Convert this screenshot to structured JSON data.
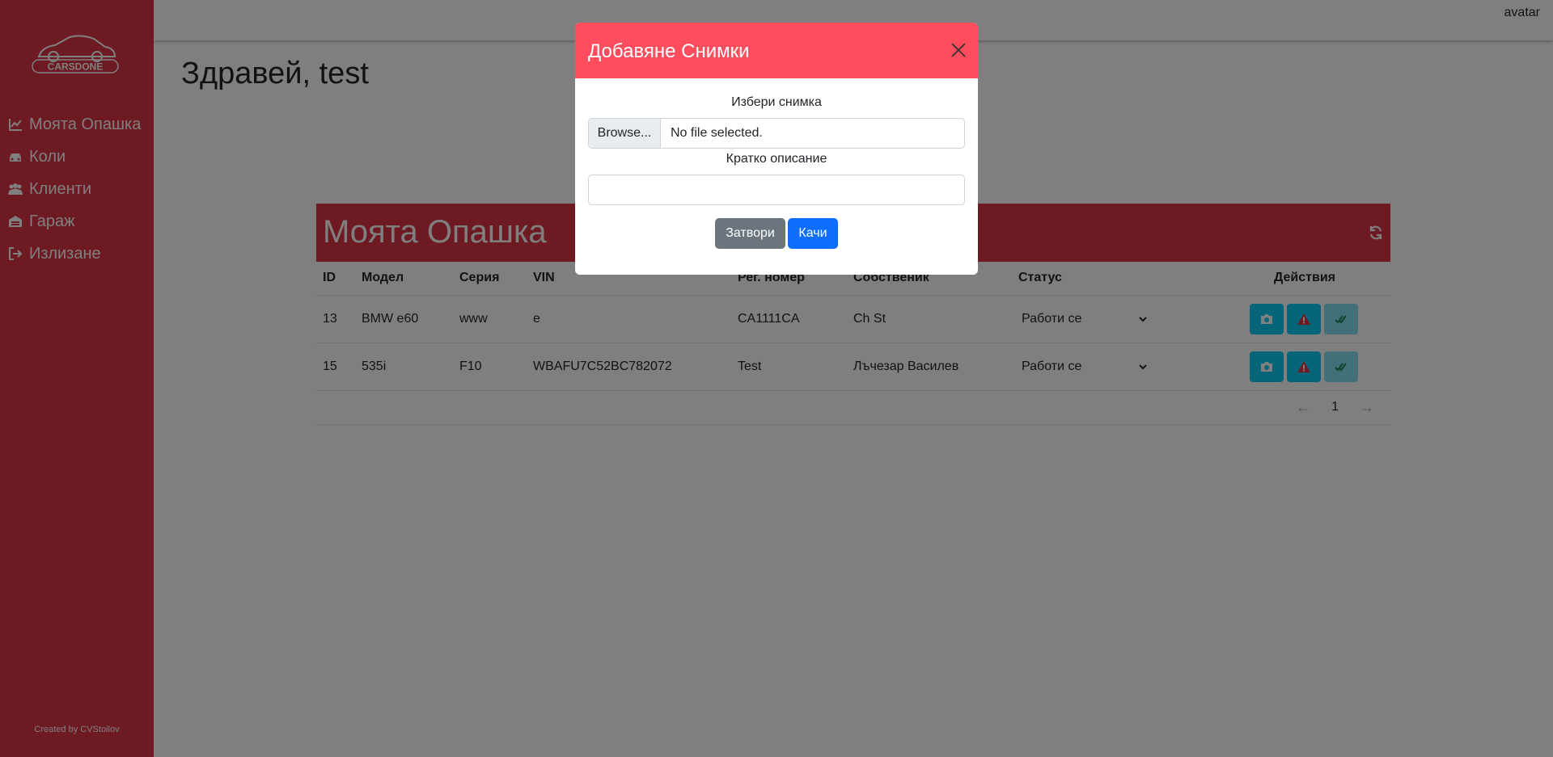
{
  "app": {
    "logo_alt": "CARSDONE",
    "user": "avatar",
    "credit": "Created by CVStoilov"
  },
  "sidebar": {
    "items": [
      {
        "label": "Моята Опашка",
        "icon": "line-chart-icon"
      },
      {
        "label": "Коли",
        "icon": "car-icon"
      },
      {
        "label": "Клиенти",
        "icon": "users-icon"
      },
      {
        "label": "Гараж",
        "icon": "warehouse-icon"
      },
      {
        "label": "Излизане",
        "icon": "sign-out-icon"
      }
    ]
  },
  "main": {
    "greeting": "Здравей, test"
  },
  "queue": {
    "title": "Моята Опашка",
    "columns": [
      "ID",
      "Модел",
      "Серия",
      "VIN",
      "Рег. номер",
      "Собственик",
      "Статус",
      "Действия"
    ],
    "rows": [
      {
        "id": "13",
        "model": "BMW e60",
        "series": "www",
        "vin": "e",
        "reg": "CA1111CA",
        "owner": "Ch St",
        "status": "Работи се"
      },
      {
        "id": "15",
        "model": "535i",
        "series": "F10",
        "vin": "WBAFU7C52BC782072",
        "reg": "Test",
        "owner": "Лъчезар Василев",
        "status": "Работи се"
      }
    ],
    "pagination": {
      "page": "1"
    }
  },
  "modal": {
    "title": "Добавяне Снимки",
    "file_label": "Избери снимка",
    "browse_label": "Browse...",
    "file_placeholder": "No file selected.",
    "desc_label": "Кратко описание",
    "desc_value": "",
    "close_label": "Затвори",
    "upload_label": "Качи"
  },
  "colors": {
    "sidebar": "#dc3545",
    "modal_header": "#ff4d5e",
    "info": "#0dcaf0",
    "danger": "#dc3545",
    "primary": "#0d6efd",
    "secondary": "#6c757d"
  }
}
